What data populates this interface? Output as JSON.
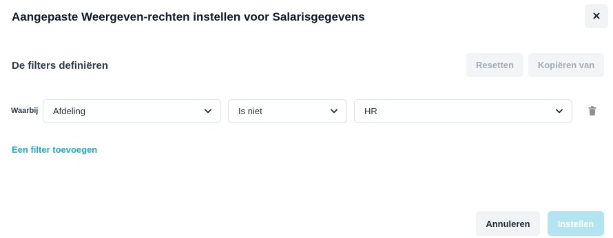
{
  "dialog": {
    "title": "Aangepaste Weergeven-rechten instellen voor Salarisgegevens",
    "close_icon": "close-icon"
  },
  "filters": {
    "section_title": "De filters definiëren",
    "reset_label": "Resetten",
    "copy_from_label": "Kopiëren van",
    "rows": [
      {
        "prefix": "Waarbij",
        "field": "Afdeling",
        "operator": "Is niet",
        "value": "HR"
      }
    ],
    "add_filter_label": "Een filter toevoegen"
  },
  "footer": {
    "cancel_label": "Annuleren",
    "apply_label": "Instellen"
  },
  "colors": {
    "accent": "#1ba8c9",
    "apply_disabled_bg": "#b3e4ef",
    "button_bg": "#f1f3f5",
    "disabled_text": "#a4abb5"
  }
}
